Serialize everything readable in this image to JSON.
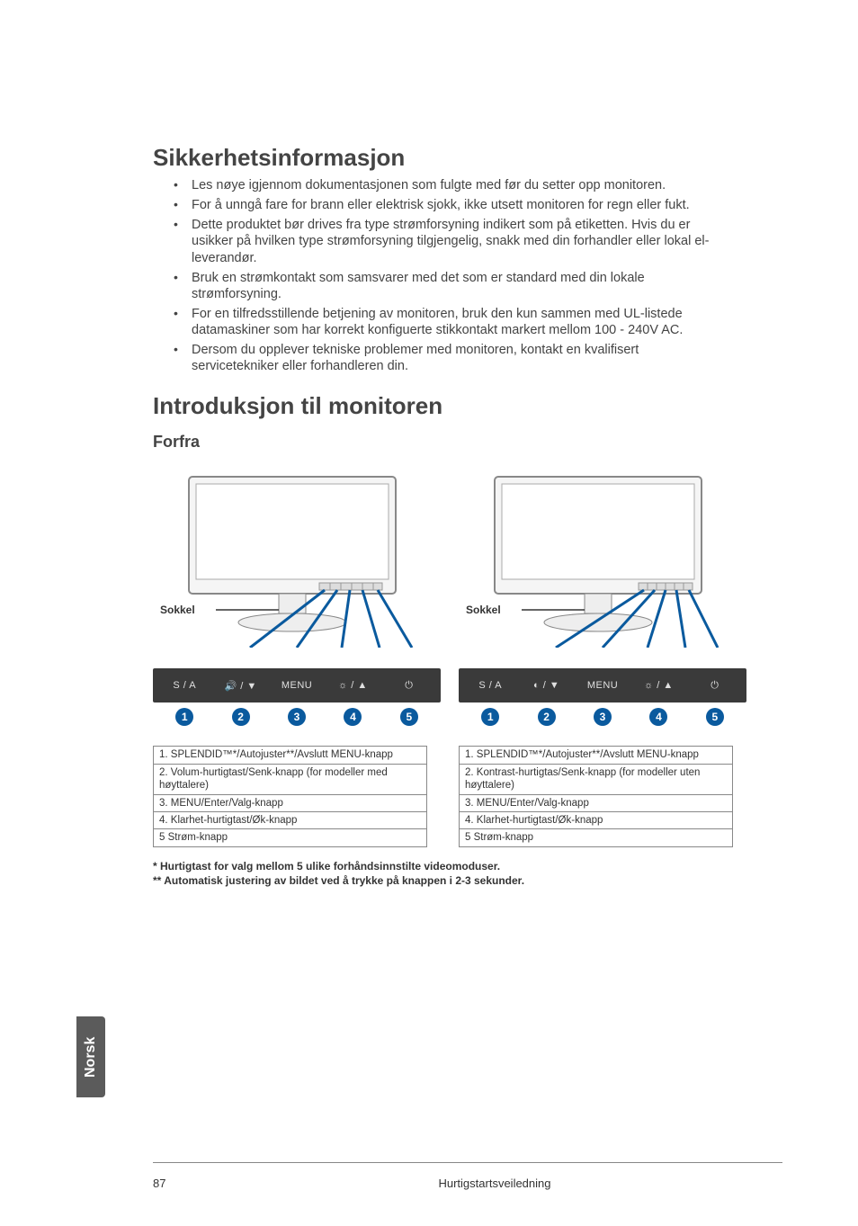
{
  "side_tab": "Norsk",
  "h_safety": "Sikkerhetsinformasjon",
  "safety_items": [
    "Les nøye igjennom dokumentasjonen som fulgte med før du setter opp monitoren.",
    "For å unngå fare for brann eller elektrisk sjokk, ikke utsett monitoren for regn eller fukt.",
    "Dette produktet bør drives fra type strømforsyning indikert som på etiketten. Hvis du er usikker på hvilken type strømforsyning tilgjengelig, snakk med din forhandler eller lokal el-leverandør.",
    "Bruk en strømkontakt som samsvarer med det som er standard med din lokale strømforsyning.",
    "For en tilfredsstillende betjening av monitoren, bruk den kun sammen med UL-listede datamaskiner som har korrekt konfiguerte stikkontakt markert mellom 100 - 240V AC.",
    "Dersom du opplever tekniske problemer med monitoren, kontakt en kvalifisert servicetekniker eller forhandleren din."
  ],
  "h_intro": "Introduksjon til monitoren",
  "h_front": "Forfra",
  "sokkel_label": "Sokkel",
  "button_icons_left": [
    "S / A",
    "🔊 / ▼",
    "MENU",
    "☼ / ▲",
    "⏻"
  ],
  "button_icons_right": [
    "S / A",
    "◐ / ▼",
    "MENU",
    "☼ / ▲",
    "⏻"
  ],
  "bubbles": [
    "1",
    "2",
    "3",
    "4",
    "5"
  ],
  "legend_left": [
    "1. SPLENDID™*/Autojuster**/Avslutt MENU-knapp",
    "2. Volum-hurtigtast/Senk-knapp (for modeller med høyttalere)",
    "3. MENU/Enter/Valg-knapp",
    "4. Klarhet-hurtigtast/Øk-knapp",
    "5 Strøm-knapp"
  ],
  "legend_right": [
    "1. SPLENDID™*/Autojuster**/Avslutt MENU-knapp",
    "2. Kontrast-hurtigtas/Senk-knapp (for modeller uten høyttalere)",
    "3. MENU/Enter/Valg-knapp",
    "4. Klarhet-hurtigtast/Øk-knapp",
    "5 Strøm-knapp"
  ],
  "footnote1": "*   Hurtigtast for valg mellom 5 ulike forhåndsinnstilte videomoduser.",
  "footnote2": "**  Automatisk justering av bildet ved å trykke på knappen i 2-3 sekunder.",
  "page_number": "87",
  "footer_title": "Hurtigstartsveiledning"
}
